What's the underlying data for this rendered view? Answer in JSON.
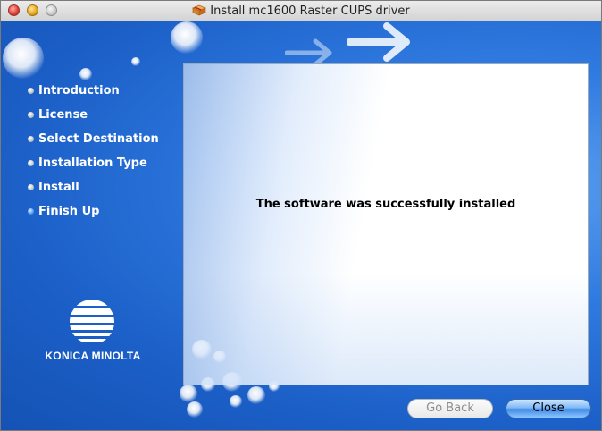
{
  "window": {
    "title": "Install mc1600 Raster CUPS driver",
    "title_icon": "package-installer-icon"
  },
  "sidebar": {
    "steps": [
      {
        "label": "Introduction",
        "current": false
      },
      {
        "label": "License",
        "current": false
      },
      {
        "label": "Select Destination",
        "current": false
      },
      {
        "label": "Installation Type",
        "current": false
      },
      {
        "label": "Install",
        "current": false
      },
      {
        "label": "Finish Up",
        "current": true
      }
    ],
    "logo_text": "KONICA MINOLTA"
  },
  "main": {
    "message": "The software was successfully installed"
  },
  "buttons": {
    "back_label": "Go Back",
    "close_label": "Close"
  },
  "colors": {
    "accent": "#1b5fc7"
  }
}
